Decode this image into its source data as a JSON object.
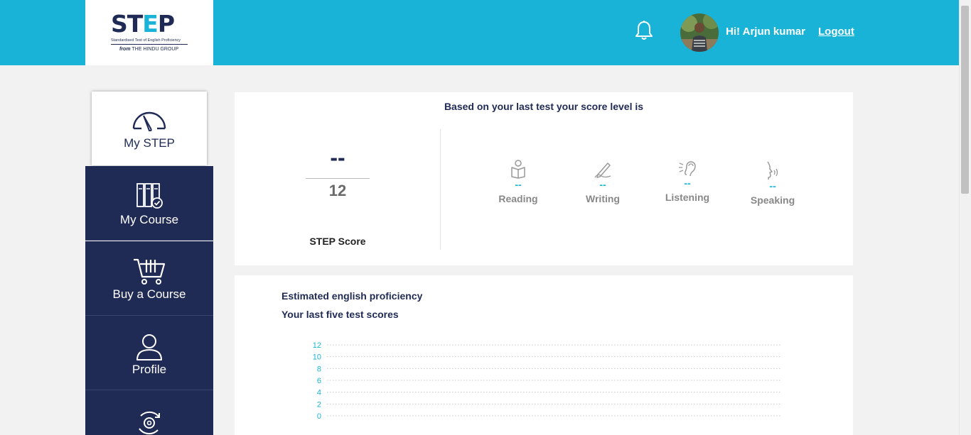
{
  "header": {
    "logo": {
      "wordmark_start": "ST",
      "wordmark_accent": "E",
      "wordmark_end": "P",
      "tagline": "Standardised Test of English Proficiency",
      "from_prefix": "from",
      "from_group": "THE HINDU GROUP"
    },
    "greeting": "Hi! Arjun kumar",
    "logout_label": "Logout",
    "icons": {
      "notifications": "bell-icon",
      "avatar": "user-photo"
    }
  },
  "sidebar": {
    "items": [
      {
        "label": "My STEP",
        "icon": "speedometer-icon",
        "active": true
      },
      {
        "label": "My Course",
        "icon": "books-check-icon"
      },
      {
        "label": "Buy a Course",
        "icon": "cart-icon"
      },
      {
        "label": "Profile",
        "icon": "person-icon"
      },
      {
        "label": "",
        "icon": "settings-cycle-icon"
      }
    ]
  },
  "score_card": {
    "heading": "Based on your last test your score level is",
    "score_value": "--",
    "score_max": "12",
    "score_label": "STEP Score",
    "skills": [
      {
        "label": "Reading",
        "value": "--",
        "icon": "reading-icon"
      },
      {
        "label": "Writing",
        "value": "--",
        "icon": "writing-icon"
      },
      {
        "label": "Listening",
        "value": "--",
        "icon": "listening-icon"
      },
      {
        "label": "Speaking",
        "value": "--",
        "icon": "speaking-icon"
      }
    ]
  },
  "proficiency_card": {
    "title": "Estimated english proficiency",
    "subtitle": "Your last five test scores"
  },
  "chart_data": {
    "type": "line",
    "title": "",
    "xlabel": "",
    "ylabel": "",
    "y_ticks": [
      "12",
      "10",
      "8",
      "6",
      "4",
      "2",
      "0"
    ],
    "ylim": [
      0,
      12
    ],
    "series": [],
    "grid": true,
    "grid_style": "dotted",
    "tick_color": "#1ab3d8"
  },
  "colors": {
    "brand_blue": "#1ab3d8",
    "navy": "#1f2a55"
  }
}
